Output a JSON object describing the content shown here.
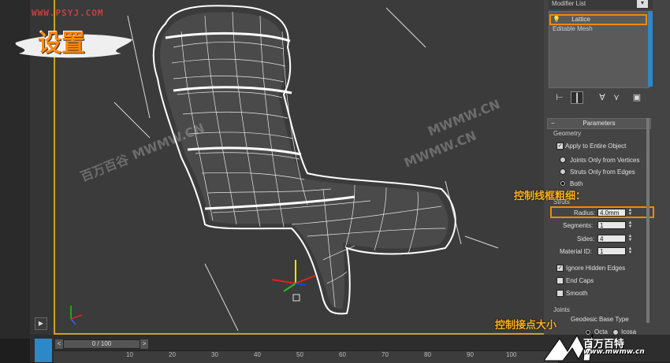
{
  "watermark_top": "WWW.PSYJ.COM",
  "title_badge": "设置",
  "viewport_watermarks": [
    "MWMW.CN",
    "MWMW.CN",
    "MWMW.CN"
  ],
  "viewport_logo_text": "百万百谷",
  "axis_labels": {
    "x": "x",
    "y": "y",
    "z": "z"
  },
  "modifier": {
    "list_label": "Modifier List",
    "stack": [
      "Lattice",
      "Editable Mesh"
    ]
  },
  "params": {
    "rollout_title": "Parameters",
    "geometry_group": "Geometry",
    "apply_entire": "Apply to Entire Object",
    "apply_entire_checked": true,
    "joints_only": "Joints Only from Vertices",
    "struts_only": "Struts Only from Edges",
    "both": "Both",
    "selected_mode": "Both",
    "struts_group": "Struts",
    "radius_label": "Radius:",
    "radius_value": "4.0mm",
    "segments_label": "Segments:",
    "segments_value": "1",
    "sides_label": "Sides:",
    "sides_value": "4",
    "material_id_label": "Material ID:",
    "material_id_value": "1",
    "ignore_hidden": "Ignore Hidden Edges",
    "ignore_hidden_checked": true,
    "end_caps": "End Caps",
    "smooth": "Smooth",
    "joints_group": "Joints",
    "geodesic": "Geodesic Base Type",
    "octa": "Octa",
    "icosa": "Icosa"
  },
  "annotations": {
    "radius_note": "控制线框粗细：",
    "joint_note": "控制接点大小"
  },
  "timeline": {
    "slider": "0 / 100",
    "ticks": [
      "10",
      "20",
      "30",
      "40",
      "50",
      "60",
      "70",
      "80",
      "90",
      "100"
    ]
  },
  "logo": {
    "brand": "百万百特",
    "url": "www.mwmw.cn"
  },
  "colors": {
    "highlight": "#f08a00",
    "viewport_border": "#c9a227",
    "accent_blue": "#2d88c9"
  }
}
